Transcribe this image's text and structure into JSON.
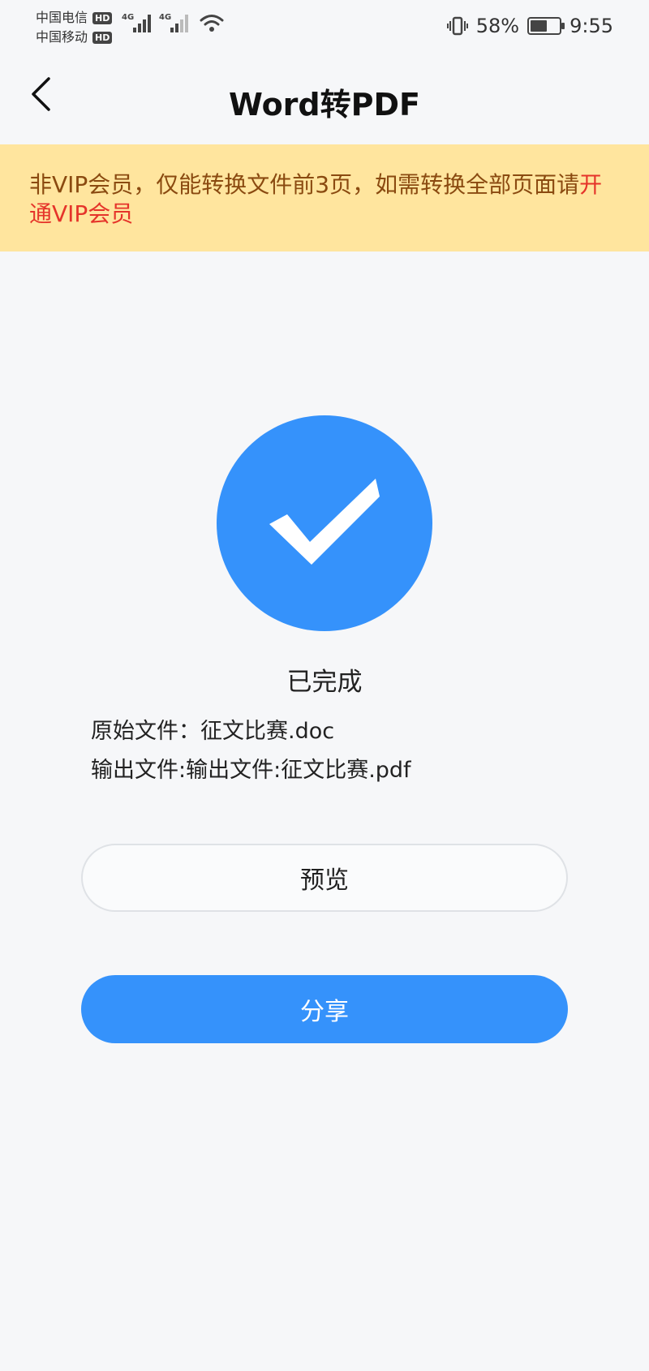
{
  "status_bar": {
    "carrier1": "中国电信",
    "carrier2": "中国移动",
    "hd_badge": "HD",
    "network1": "4G",
    "network2": "4G",
    "battery_percent": "58%",
    "battery_level": 0.58,
    "time": "9:55"
  },
  "header": {
    "back_icon": "chevron-left-icon",
    "title": "Word转PDF"
  },
  "notice": {
    "text": "非VIP会员，仅能转换文件前3页，如需转换全部页面请",
    "link": "开通VIP会员"
  },
  "result": {
    "icon": "check-icon",
    "status": "已完成",
    "original_file": "原始文件：征文比赛.doc",
    "output_file": "输出文件:输出文件:征文比赛.pdf"
  },
  "buttons": {
    "preview": "预览",
    "share": "分享"
  },
  "colors": {
    "accent": "#3592fb",
    "notice_bg": "#ffe59e",
    "notice_text": "#8a4a10",
    "notice_link": "#e5342a"
  }
}
